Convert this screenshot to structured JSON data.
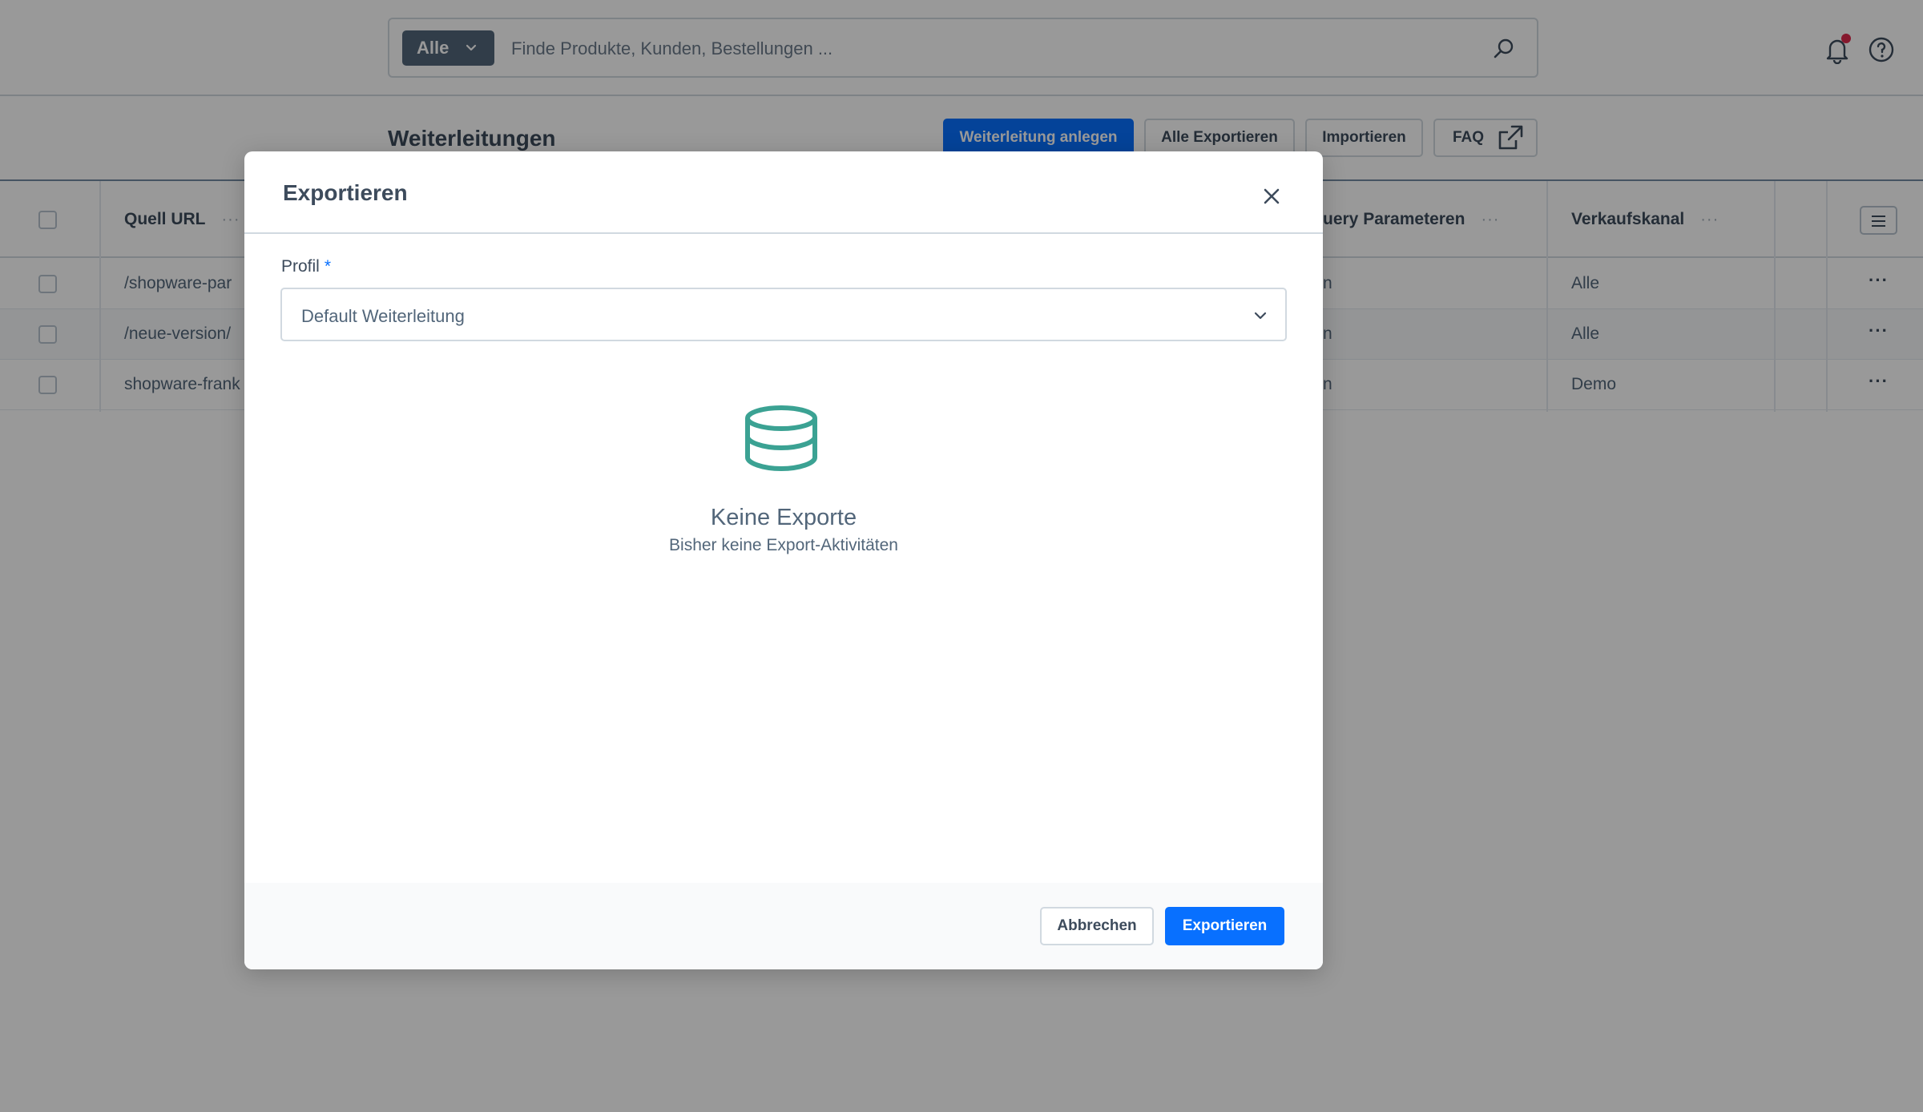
{
  "search": {
    "type_label": "Alle",
    "placeholder": "Finde Produkte, Kunden, Bestellungen ..."
  },
  "page": {
    "title": "Weiterleitungen",
    "actions": {
      "create": "Weiterleitung anlegen",
      "export_all": "Alle Exportieren",
      "import": "Importieren",
      "faq": "FAQ"
    }
  },
  "grid": {
    "columns": [
      "Quell URL",
      "uery Parameteren",
      "Verkaufskanal"
    ],
    "rows": [
      {
        "source_url": "/shopware-par",
        "query_param": "n",
        "sales_channel": "Alle"
      },
      {
        "source_url": "/neue-version/",
        "query_param": "n",
        "sales_channel": "Alle"
      },
      {
        "source_url": "shopware-frank",
        "query_param": "n",
        "sales_channel": "Demo"
      }
    ],
    "row_menu": "···",
    "col_menu": "···"
  },
  "modal": {
    "title": "Exportieren",
    "profile_label": "Profil",
    "required_mark": "*",
    "profile_value": "Default Weiterleitung",
    "empty_title": "Keine Exporte",
    "empty_subtitle": "Bisher keine Export-Aktivitäten",
    "cancel_label": "Abbrechen",
    "export_label": "Exportieren"
  },
  "colors": {
    "primary": "#0870ff",
    "text": "#3d4b5c",
    "notification": "#de294c",
    "empty_icon": "#3ba293"
  }
}
